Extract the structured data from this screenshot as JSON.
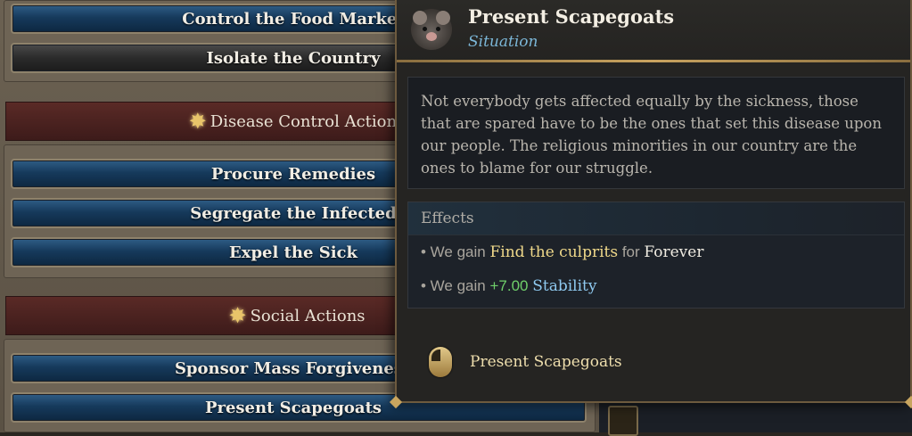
{
  "buttons": {
    "control_food_market": "Control the Food Market",
    "isolate_country": "Isolate the Country",
    "procure_remedies": "Procure Remedies",
    "segregate_infected": "Segregate the Infected",
    "expel_sick": "Expel the Sick",
    "sponsor_mass_forgiveness": "Sponsor Mass Forgiveness",
    "present_scapegoats": "Present Scapegoats"
  },
  "sections": {
    "disease_control": "Disease Control Actions",
    "social": "Social Actions"
  },
  "icons": {
    "section": "star-icon",
    "tooltip": "rat-icon",
    "action": "mouse-left-click-icon"
  },
  "tooltip": {
    "title": "Present Scapegoats",
    "subtitle": "Situation",
    "description": "Not everybody gets affected equally by the sickness, those that are spared have to be the ones that set this disease upon our people. The religious minorities in our country are the ones to blame for our struggle.",
    "effects_header": "Effects",
    "effects": [
      {
        "prefix": "• We gain ",
        "highlight": "Find the culprits",
        "middle": " for ",
        "end": "Forever"
      },
      {
        "prefix": "• We gain ",
        "value": "+7.00",
        "stat": "Stability"
      }
    ],
    "action_label": "Present Scapegoats"
  },
  "colors": {
    "button_blue": "#163a5c",
    "section_red": "#4a2220",
    "accent_gold": "#c9a35f",
    "subtitle_blue": "#7cb7d8",
    "positive_green": "#6fcf6a"
  }
}
